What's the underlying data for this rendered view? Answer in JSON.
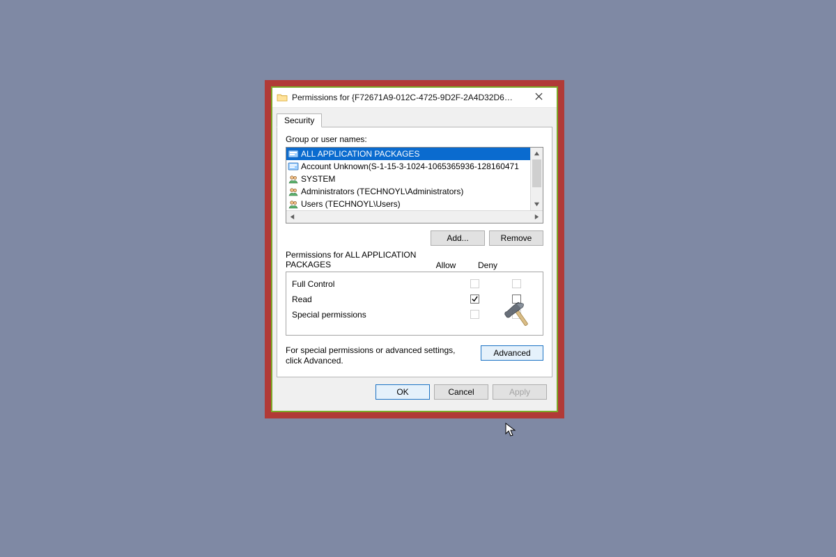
{
  "titlebar": {
    "title": "Permissions for {F72671A9-012C-4725-9D2F-2A4D32D6…"
  },
  "tab": {
    "label": "Security"
  },
  "group_label": "Group or user names:",
  "users": [
    {
      "name": "ALL APPLICATION PACKAGES",
      "icon": "sid",
      "selected": true
    },
    {
      "name": "Account Unknown(S-1-15-3-1024-1065365936-128160471",
      "icon": "sid",
      "selected": false
    },
    {
      "name": "SYSTEM",
      "icon": "grp",
      "selected": false
    },
    {
      "name": "Administrators (TECHNOYL\\Administrators)",
      "icon": "grp",
      "selected": false
    },
    {
      "name": "Users (TECHNOYL\\Users)",
      "icon": "grp",
      "selected": false
    }
  ],
  "buttons": {
    "add": "Add...",
    "remove": "Remove",
    "advanced": "Advanced",
    "ok": "OK",
    "cancel": "Cancel",
    "apply": "Apply"
  },
  "perm_label": "Permissions for ALL APPLICATION PACKAGES",
  "perm_cols": {
    "allow": "Allow",
    "deny": "Deny"
  },
  "permissions": [
    {
      "name": "Full Control",
      "allow": false,
      "deny": false,
      "dim": true
    },
    {
      "name": "Read",
      "allow": true,
      "deny": false,
      "dim": false
    },
    {
      "name": "Special permissions",
      "allow": false,
      "deny": false,
      "dim": true
    }
  ],
  "advanced_text": "For special permissions or advanced settings, click Advanced."
}
